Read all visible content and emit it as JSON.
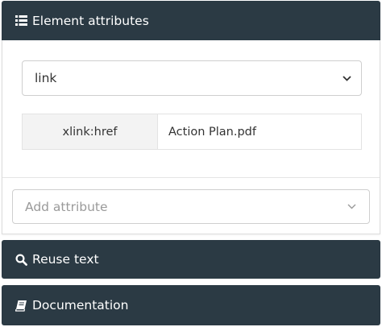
{
  "panels": {
    "attributes": {
      "title": "Element attributes",
      "icon": "list-icon"
    },
    "reuse": {
      "title": "Reuse text",
      "icon": "search-icon"
    },
    "docs": {
      "title": "Documentation",
      "icon": "book-icon"
    }
  },
  "element_select": {
    "value": "link"
  },
  "attributes": [
    {
      "name": "xlink:href",
      "value": "Action Plan.pdf"
    }
  ],
  "add_attribute": {
    "placeholder": "Add attribute"
  },
  "colors": {
    "header_bg": "#2b3a44",
    "name_cell_bg": "#f3f3f3"
  }
}
